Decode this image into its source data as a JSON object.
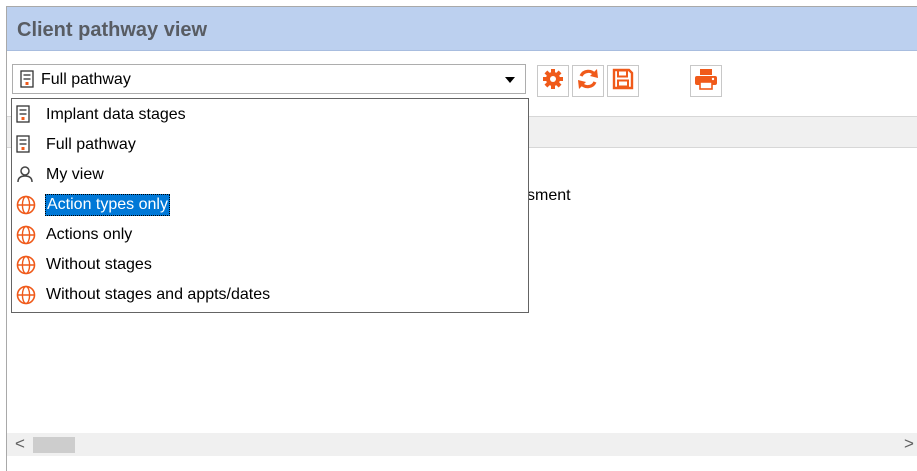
{
  "window": {
    "title": "Client pathway view"
  },
  "view_selector": {
    "selected_value": "Full pathway"
  },
  "toolbar": {
    "settings_icon": "gear-icon",
    "refresh_icon": "refresh-icon",
    "save_icon": "save-icon",
    "print_icon": "printer-icon",
    "accent_color": "#f05a1a"
  },
  "content": {
    "partial_text": "sment"
  },
  "dropdown": {
    "items": [
      {
        "label": "Implant data stages",
        "icon": "document-icon"
      },
      {
        "label": "Full pathway",
        "icon": "document-icon"
      },
      {
        "label": "My view",
        "icon": "person-icon"
      },
      {
        "label": "Action types only",
        "icon": "globe-icon",
        "selected": true
      },
      {
        "label": "Actions only",
        "icon": "globe-icon"
      },
      {
        "label": "Without stages",
        "icon": "globe-icon"
      },
      {
        "label": "Without stages and appts/dates",
        "icon": "globe-icon"
      }
    ]
  },
  "scrollbar": {
    "left_arrow": "<",
    "right_arrow": ">"
  },
  "colors": {
    "titlebar": "#bcd0ef",
    "selection": "#0078d7"
  }
}
